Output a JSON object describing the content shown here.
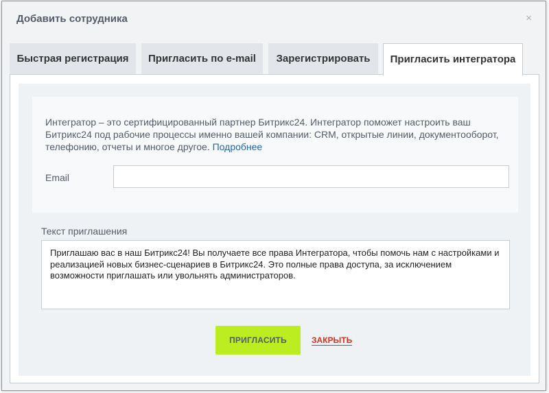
{
  "dialog": {
    "title": "Добавить сотрудника",
    "close_symbol": "×"
  },
  "tabs": [
    {
      "label": "Быстрая регистрация",
      "active": false
    },
    {
      "label": "Пригласить по e-mail",
      "active": false
    },
    {
      "label": "Зарегистрировать",
      "active": false
    },
    {
      "label": "Пригласить интегратора",
      "active": true
    }
  ],
  "info": {
    "text": "Интегратор – это сертифицированный партнер Битрикс24. Интегратор поможет настроить ваш Битрикс24 под рабочие процессы именно вашей компании: CRM, открытые линии, документооборот, телефонию, отчеты и многое другое.",
    "link_label": "Подробнее"
  },
  "email": {
    "label": "Email",
    "value": ""
  },
  "invitation": {
    "label": "Текст приглашения",
    "text": "Приглашаю вас в наш Битрикс24! Вы получаете все права Интегратора, чтобы помочь нам с настройками и реализацией новых бизнес-сценариев в Битрикс24. Это полные права доступа, за исключением возможности приглашать или увольнять администраторов."
  },
  "buttons": {
    "invite_label": "ПРИГЛАСИТЬ",
    "close_label": "ЗАКРЫТЬ"
  },
  "colors": {
    "accent_green": "#bbed21",
    "link_blue": "#2067b0",
    "close_red": "#e0301e"
  }
}
